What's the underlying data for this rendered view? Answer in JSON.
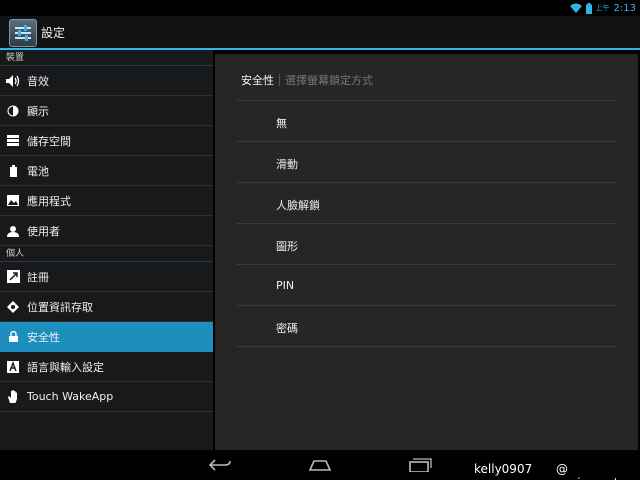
{
  "status_bar": {
    "ampm": "上午",
    "time": "2:13"
  },
  "app": {
    "title": "設定"
  },
  "sidebar": {
    "sections": [
      {
        "header": "裝置",
        "items": [
          {
            "label": "音效",
            "icon": "volume-icon"
          },
          {
            "label": "顯示",
            "icon": "brightness-icon"
          },
          {
            "label": "儲存空間",
            "icon": "storage-icon"
          },
          {
            "label": "電池",
            "icon": "battery-icon"
          },
          {
            "label": "應用程式",
            "icon": "apps-icon"
          },
          {
            "label": "使用者",
            "icon": "user-icon"
          }
        ]
      },
      {
        "header": "個人",
        "items": [
          {
            "label": "註冊",
            "icon": "account-icon"
          },
          {
            "label": "位置資訊存取",
            "icon": "location-icon"
          },
          {
            "label": "安全性",
            "icon": "lock-icon",
            "active": true
          },
          {
            "label": "語言與輸入設定",
            "icon": "keyboard-a-icon"
          },
          {
            "label": "Touch WakeApp",
            "icon": "hand-icon"
          }
        ]
      }
    ]
  },
  "content": {
    "breadcrumb_title": "安全性",
    "breadcrumb_subtitle": "選擇螢幕鎖定方式",
    "options": [
      "無",
      "滑動",
      "人臉解鎖",
      "圖形",
      "PIN",
      "密碼"
    ]
  },
  "watermark": {
    "left": "kelly0907",
    "right": "@ sogi.com.tw"
  },
  "colors": {
    "accent": "#33b5e5",
    "active_item": "#1d8fbf"
  }
}
